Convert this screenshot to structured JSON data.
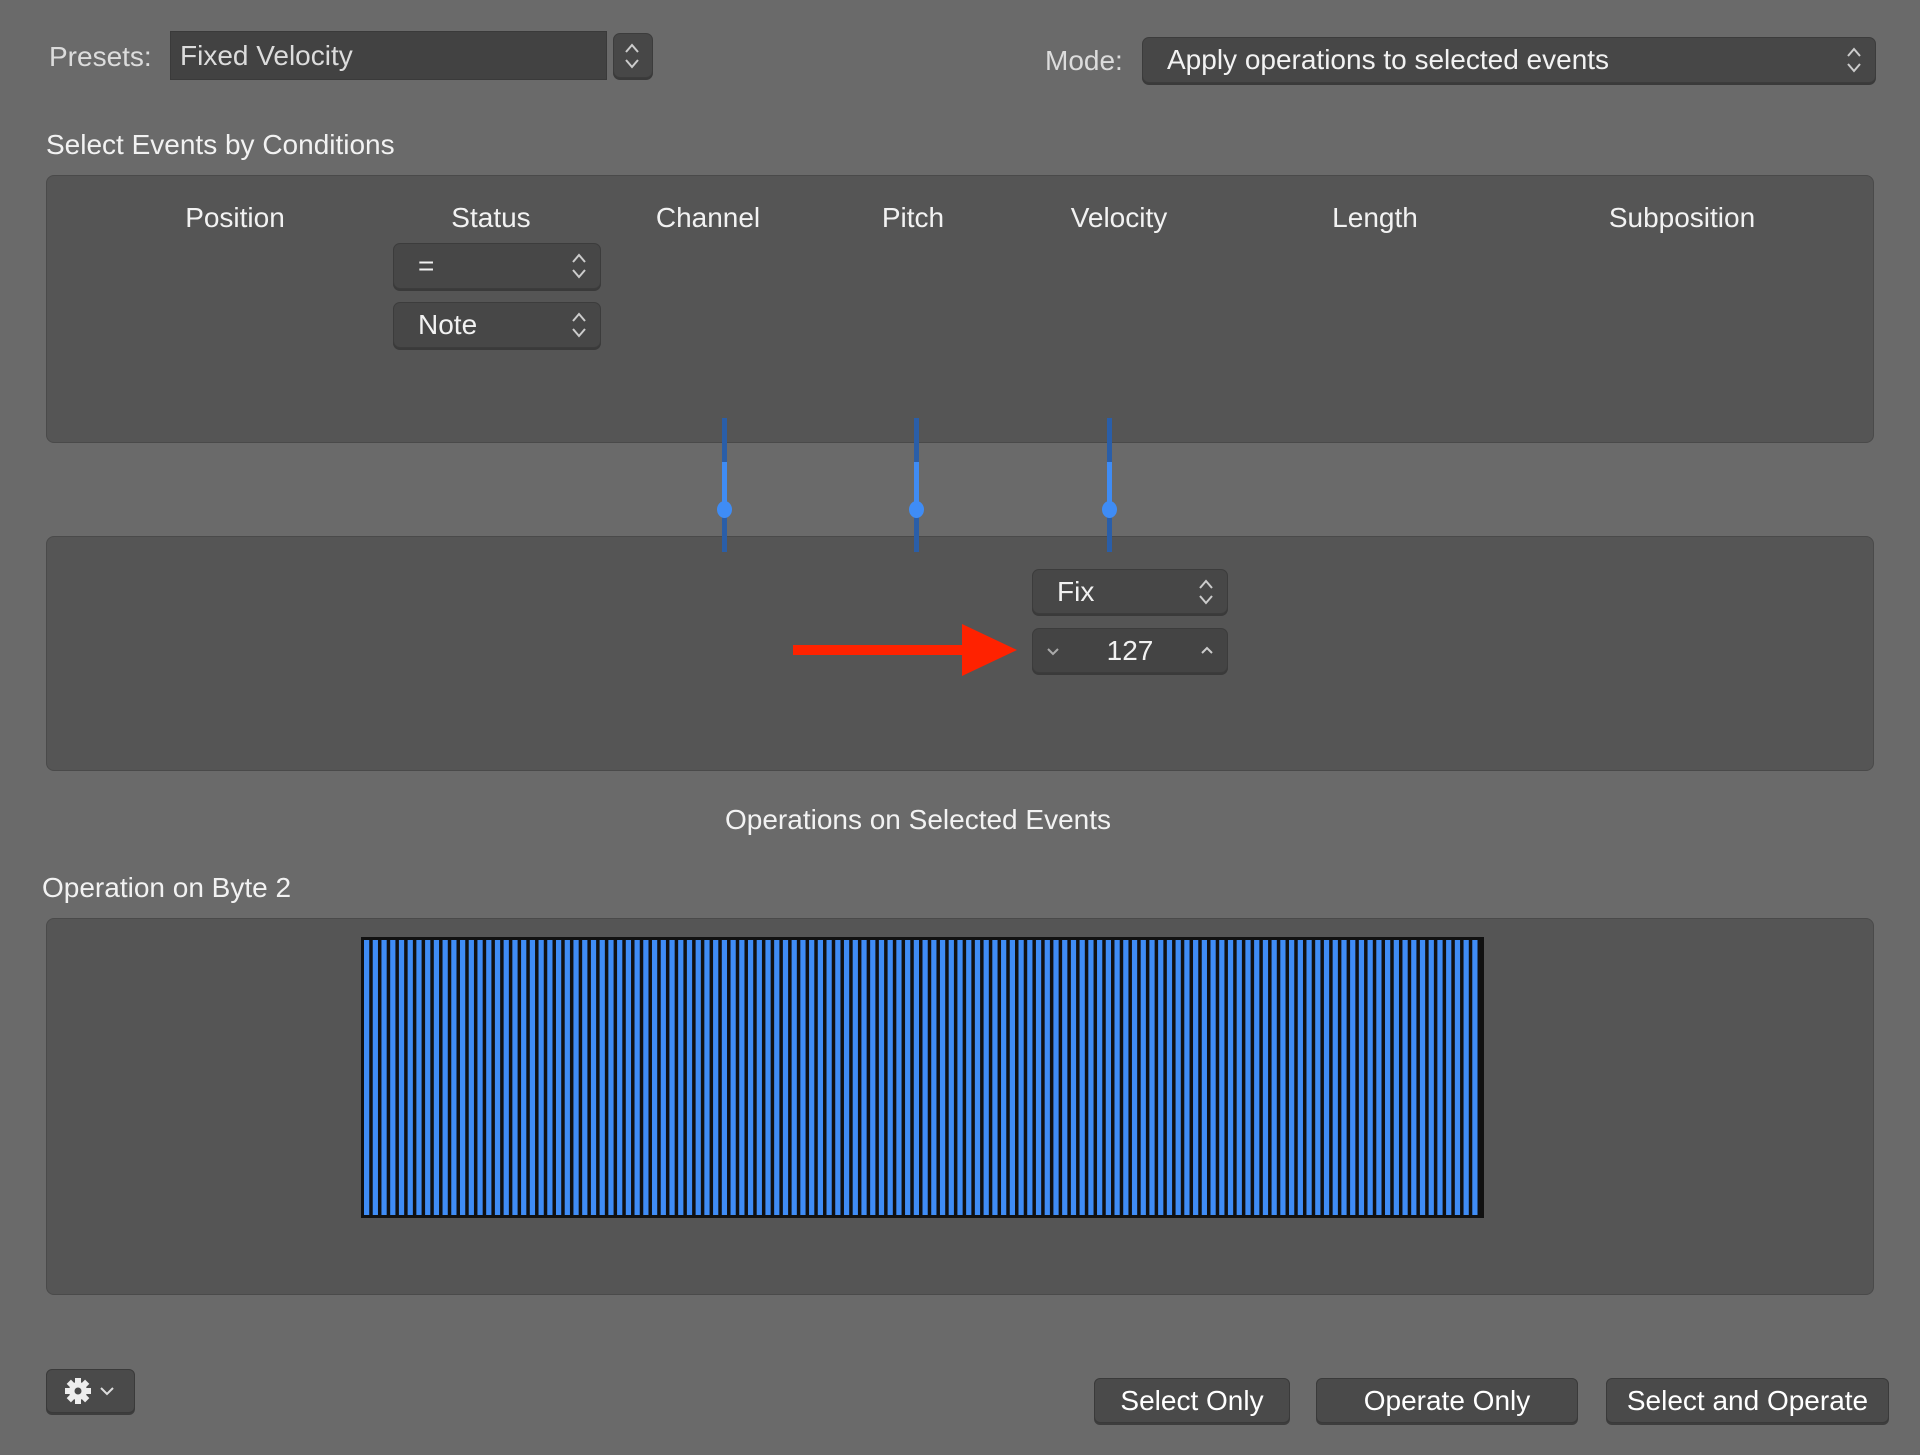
{
  "header": {
    "presets_label": "Presets:",
    "presets_value": "Fixed Velocity",
    "mode_label": "Mode:",
    "mode_value": "Apply operations to selected events"
  },
  "conditions": {
    "title": "Select Events by Conditions",
    "columns": [
      "Position",
      "Status",
      "Channel",
      "Pitch",
      "Velocity",
      "Length",
      "Subposition"
    ],
    "status_operator": "=",
    "status_value": "Note"
  },
  "operations": {
    "velocity_operation": "Fix",
    "velocity_value": "127",
    "section_title": "Operations on Selected Events",
    "byte2_title": "Operation on Byte 2"
  },
  "annotation": {
    "arrow_color": "#ff2200"
  },
  "chart_data": {
    "type": "bar",
    "x_range": [
      0,
      127
    ],
    "values_rule": "all inputs mapped to 127",
    "count": 128,
    "value": 127,
    "ylim": [
      0,
      127
    ],
    "bar_color": "#3f8cf5"
  },
  "footer": {
    "gear_icon": "gear-icon",
    "select_only": "Select Only",
    "operate_only": "Operate Only",
    "select_and_operate": "Select and Operate"
  },
  "colors": {
    "accent": "#3f8cf5",
    "background": "#6a6a6a",
    "panel": "#555555"
  }
}
